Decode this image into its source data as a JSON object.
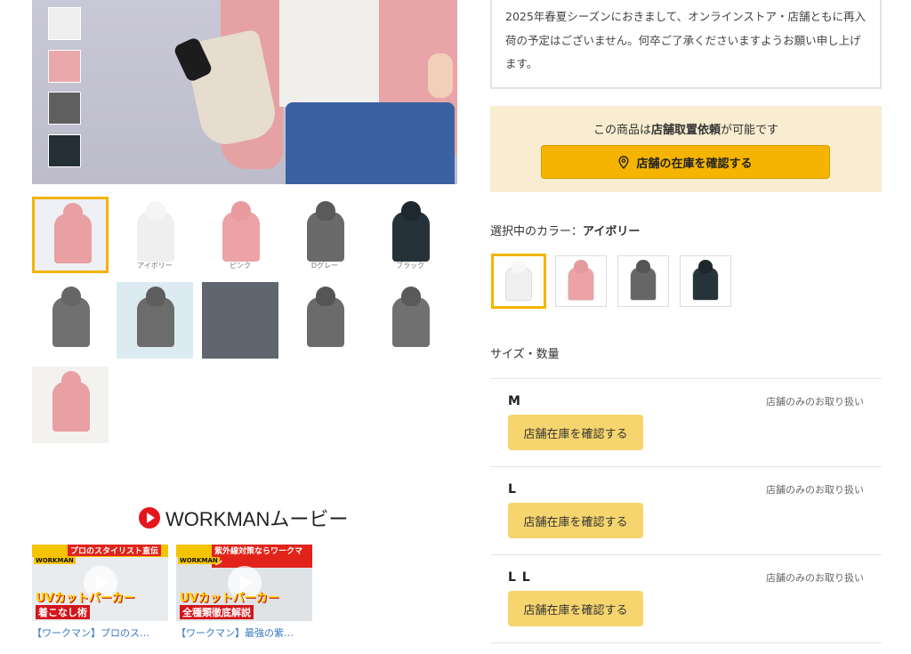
{
  "gallery": {
    "swatch_colors": [
      "#eeeeee",
      "#eaa8ab",
      "#5f5f5f",
      "#243036"
    ],
    "thumbnails": [
      {
        "caption": "",
        "color": "#e8a0a2",
        "hood": "#e8a0a2",
        "bg": "#eef0f5"
      },
      {
        "caption": "アイボリー",
        "color": "#efefef",
        "hood": "#f5f5f5",
        "bg": "#ffffff"
      },
      {
        "caption": "ピンク",
        "color": "#eba3a6",
        "hood": "#e99a9d",
        "bg": "#ffffff"
      },
      {
        "caption": "Dグレー",
        "color": "#6a6a6a",
        "hood": "#5a5a5a",
        "bg": "#ffffff"
      },
      {
        "caption": "ブラック",
        "color": "#26323a",
        "hood": "#1e282e",
        "bg": "#ffffff"
      },
      {
        "caption": "",
        "color": "#707070",
        "hood": "#666666",
        "bg": "#ffffff"
      },
      {
        "caption": "",
        "color": "#6c6c6c",
        "hood": "#5e5e5e",
        "bg": "#dcebf2"
      },
      {
        "caption": "",
        "color": "#5f6670",
        "hood": "#5f6670",
        "bg": "#5f6670"
      },
      {
        "caption": "",
        "color": "#6b6b6b",
        "hood": "#555555",
        "bg": "#ffffff"
      },
      {
        "caption": "",
        "color": "#707070",
        "hood": "#5a5a5a",
        "bg": "#ffffff"
      },
      {
        "caption": "",
        "color": "#e8a0a2",
        "hood": "#e8a0a2",
        "bg": "#f4f2ef"
      }
    ]
  },
  "movies": {
    "title": "WORKMANムービー",
    "videos": [
      {
        "band_text": "プロのスタイリスト直伝",
        "brand": "WORKMAN",
        "line1": "UVカットパーカー",
        "line2": "着こなし術",
        "caption": "【ワークマン】プロのス…"
      },
      {
        "band_text": "紫外線対策ならワークマン",
        "brand": "WORKMAN",
        "line1": "UVカットパーカー",
        "line2": "全種類徹底解説",
        "caption": "【ワークマン】最強の紫…"
      }
    ]
  },
  "notice": {
    "text": "2025年春夏シーズンにおきまして、オンラインストア・店舗ともに再入荷の予定はございません。何卒ご了承くださいますようお願い申し上げます。"
  },
  "pickup": {
    "text_prefix": "この商品は",
    "text_bold": "店舗取置依頼",
    "text_suffix": "が可能です",
    "button_label": "店舗の在庫を確認する"
  },
  "color_select": {
    "label": "選択中のカラー：",
    "selected": "アイボリー",
    "options": [
      {
        "name": "アイボリー",
        "color": "#f0f0f0",
        "hood": "#f7f7f7"
      },
      {
        "name": "ピンク",
        "color": "#eba3a6",
        "hood": "#e49a9d"
      },
      {
        "name": "Dグレー",
        "color": "#666666",
        "hood": "#555555"
      },
      {
        "name": "ブラック",
        "color": "#27333a",
        "hood": "#1d272c"
      }
    ]
  },
  "sizes": {
    "heading": "サイズ・数量",
    "rows": [
      {
        "name": "M",
        "note": "店舗のみのお取り扱い",
        "button": "店舗在庫を確認する"
      },
      {
        "name": "L",
        "note": "店舗のみのお取り扱い",
        "button": "店舗在庫を確認する"
      },
      {
        "name": "L L",
        "note": "店舗のみのお取り扱い",
        "button": "店舗在庫を確認する"
      }
    ]
  },
  "colors": {
    "accent": "#f5b400",
    "size_button": "#f7d56e",
    "pickup_bg": "#f8edd0",
    "link": "#3b78c4",
    "youtube_red": "#e4161b"
  }
}
